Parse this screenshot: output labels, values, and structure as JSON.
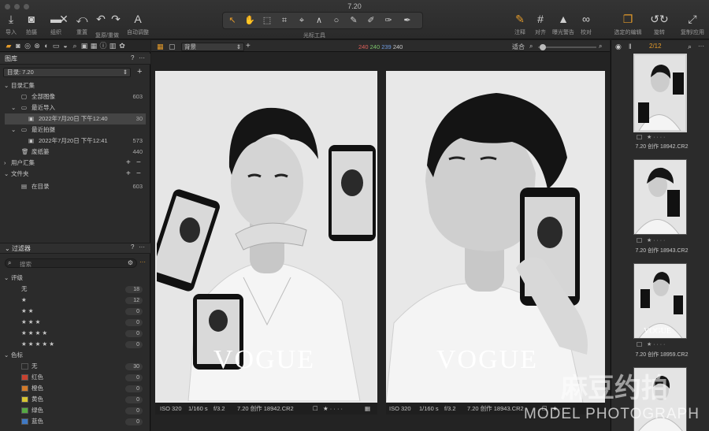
{
  "window": {
    "title": "7.20"
  },
  "toolbar": {
    "left": [
      {
        "icon": "import-icon",
        "glyph": "⤓",
        "label": "导入"
      },
      {
        "icon": "camera-icon",
        "glyph": "◙",
        "label": "拍摄"
      },
      {
        "icon": "folder-icon",
        "glyph": "▬",
        "label": "组织"
      },
      {
        "icon": "delete-icon",
        "glyph": "✕",
        "label": ""
      },
      {
        "icon": "reset-icon",
        "glyph": "⤺",
        "label": "重置"
      },
      {
        "icon": "undo-icon",
        "glyph": "↶",
        "label": "复原/重做"
      },
      {
        "icon": "redo-icon",
        "glyph": "↷",
        "label": ""
      },
      {
        "icon": "auto-adjust-icon",
        "glyph": "A",
        "label": "自动调整"
      }
    ],
    "cursor_tools_label": "光标工具",
    "cursor_tools": [
      "↖",
      "✋",
      "⬚",
      "⌗",
      "⌖",
      "∧",
      "○",
      "✎",
      "✐",
      "✑",
      "✒"
    ],
    "right": [
      {
        "icon": "annotate-icon",
        "glyph": "✎",
        "label": "注释"
      },
      {
        "icon": "grid-icon",
        "glyph": "#",
        "label": "对齐"
      },
      {
        "icon": "warning-icon",
        "glyph": "▲",
        "label": "曝光警告"
      },
      {
        "icon": "proof-icon",
        "glyph": "∞",
        "label": "校对"
      },
      {
        "icon": "edit-selected-icon",
        "glyph": "❐",
        "label": "选定的编辑"
      },
      {
        "icon": "rotate-icon",
        "glyph": "↺↻",
        "label": "旋转"
      },
      {
        "icon": "export-icon",
        "glyph": "⤢",
        "label": "复制/应用"
      }
    ]
  },
  "library": {
    "title": "图库",
    "catalog": "目录: 7.20",
    "catalog_collection": "目录汇集",
    "all_images": "全部图像",
    "all_images_count": "603",
    "recent_imports": "最近导入",
    "import_date": "2022年7月20日 下午12:40",
    "import_count": "30",
    "recent_captures": "最近拍摄",
    "capture_date": "2022年7月20日 下午12:41",
    "capture_count": "573",
    "trash": "废纸篓",
    "trash_count": "440",
    "user_collection": "用户汇集",
    "folders": "文件夹",
    "in_catalog": "在目录",
    "in_catalog_count": "603"
  },
  "filters": {
    "title": "过滤器",
    "search_placeholder": "搜索",
    "rating_title": "评级",
    "ratings": [
      {
        "label": "无",
        "count": "18"
      },
      {
        "label": "★",
        "count": "12"
      },
      {
        "label": "★ ★",
        "count": "0"
      },
      {
        "label": "★ ★ ★",
        "count": "0"
      },
      {
        "label": "★ ★ ★ ★",
        "count": "0"
      },
      {
        "label": "★ ★ ★ ★ ★",
        "count": "0"
      }
    ],
    "color_title": "色标",
    "colors": [
      {
        "label": "无",
        "count": "30",
        "color": "#2a2a2a"
      },
      {
        "label": "红色",
        "count": "0",
        "color": "#c8412f"
      },
      {
        "label": "橙色",
        "count": "0",
        "color": "#d27a2a"
      },
      {
        "label": "黄色",
        "count": "0",
        "color": "#d6c433"
      },
      {
        "label": "绿色",
        "count": "0",
        "color": "#55a943"
      },
      {
        "label": "蓝色",
        "count": "0",
        "color": "#3f79c4"
      }
    ]
  },
  "viewer": {
    "background_select": "背景",
    "rgb": {
      "r": "240",
      "g": "240",
      "b": "239",
      "a": "240"
    },
    "fit": "适合",
    "left_image": {
      "iso": "ISO 320",
      "shutter": "1/160 s",
      "aperture": "f/3.2",
      "name": "7.20 创作 18942.CR2",
      "overlay_text": "VOGUE"
    },
    "right_image": {
      "iso": "ISO 320",
      "shutter": "1/160 s",
      "aperture": "f/3.2",
      "name": "7.20 创作 18943.CR2",
      "overlay_text": "VOGUE"
    }
  },
  "browser": {
    "page": "2/12",
    "thumbs": [
      {
        "name": "7.20 创作 18942.CR2"
      },
      {
        "name": "7.20 创作 18943.CR2"
      },
      {
        "name": "7.20 创作 18959.CR2"
      }
    ]
  },
  "watermark": {
    "cn": "麻豆约拍",
    "en": "MODEL PHOTOGRAPH"
  }
}
